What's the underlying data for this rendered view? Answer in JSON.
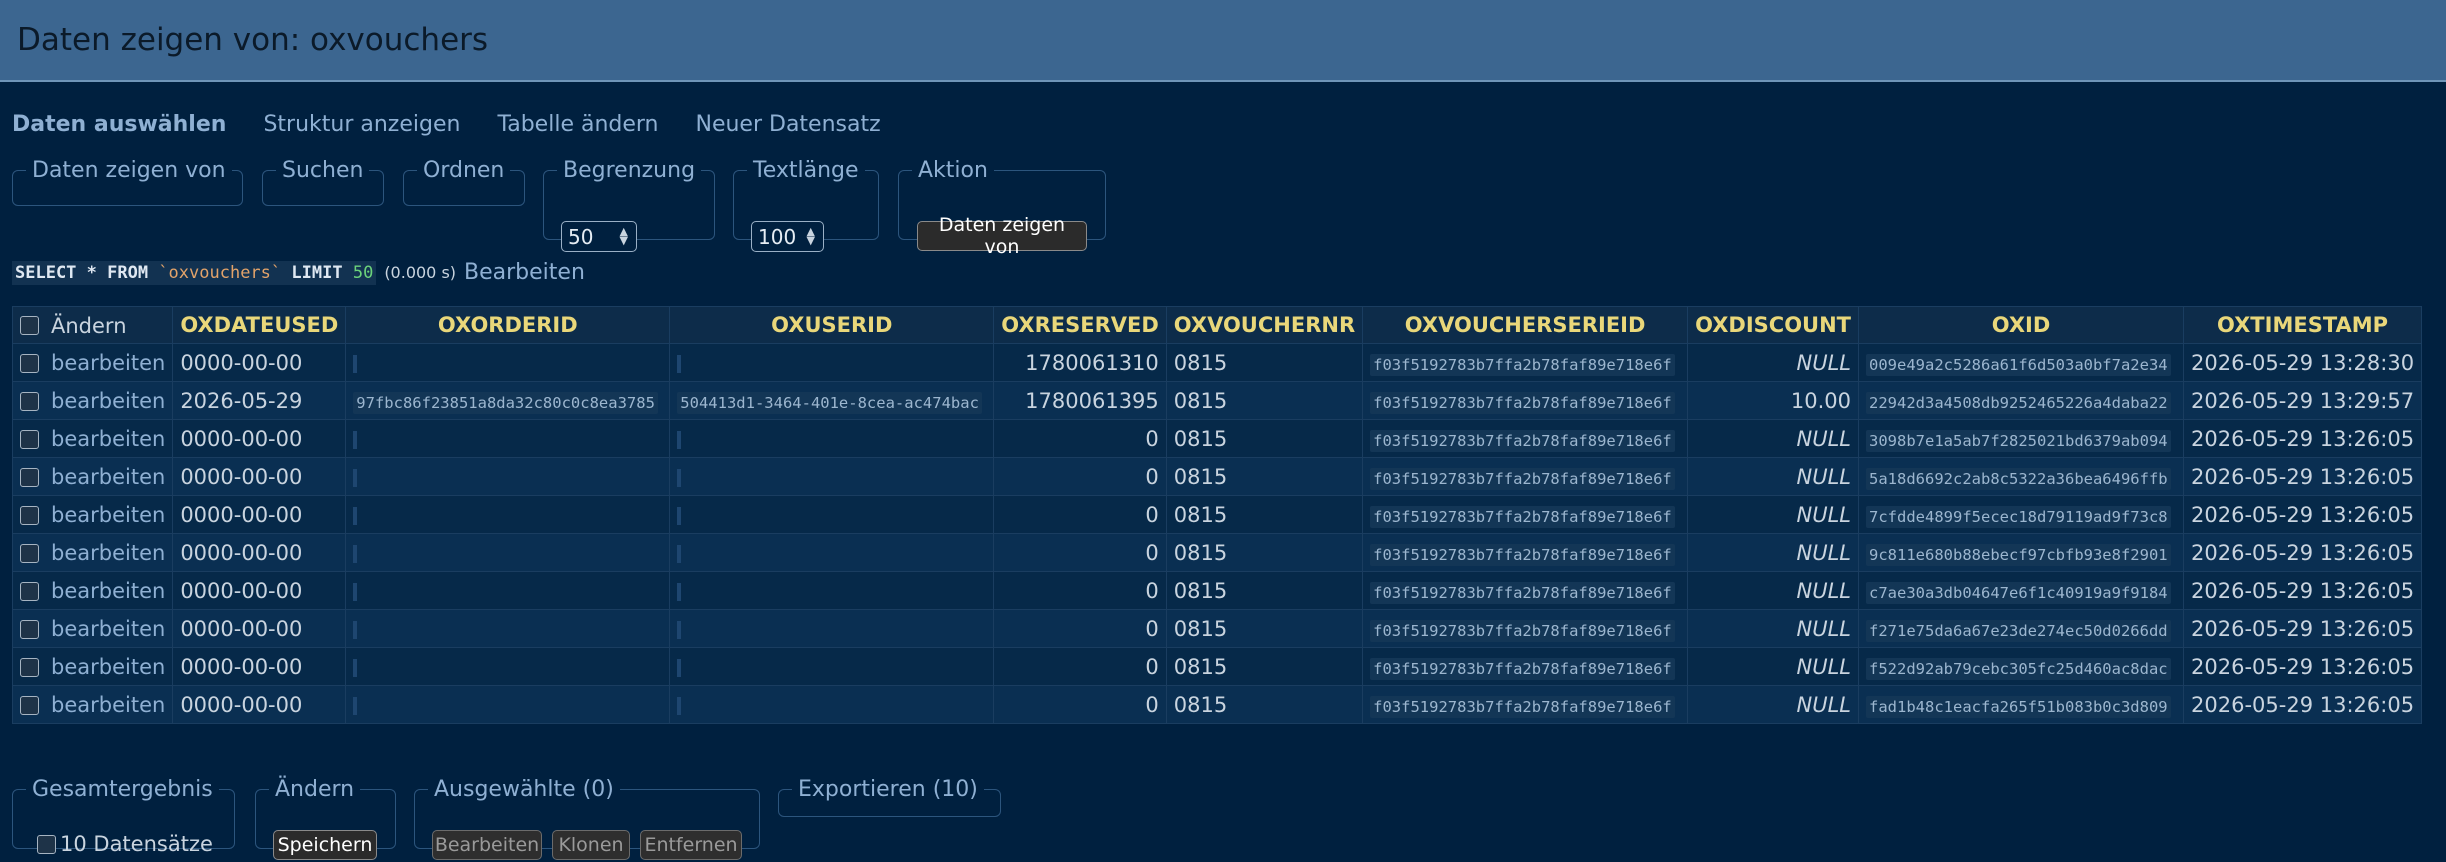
{
  "header": {
    "title": "Daten zeigen von: oxvouchers"
  },
  "tabs": [
    {
      "label": "Daten auswählen",
      "active": true
    },
    {
      "label": "Struktur anzeigen"
    },
    {
      "label": "Tabelle ändern"
    },
    {
      "label": "Neuer Datensatz"
    }
  ],
  "filters": {
    "select_legend": "Daten zeigen von",
    "search_legend": "Suchen",
    "order_legend": "Ordnen",
    "limit_legend": "Begrenzung",
    "limit_value": "50",
    "textlength_legend": "Textlänge",
    "textlength_value": "100",
    "action_legend": "Aktion",
    "action_button": "Daten zeigen von"
  },
  "query": {
    "keyword_select": "SELECT * FROM",
    "table": "`oxvouchers`",
    "keyword_limit": "LIMIT",
    "limit": "50",
    "time": "(0.000 s)",
    "edit_link": "Bearbeiten"
  },
  "table": {
    "edit_header": "Ändern",
    "columns": [
      "OXDATEUSED",
      "OXORDERID",
      "OXUSERID",
      "OXRESERVED",
      "OXVOUCHERNR",
      "OXVOUCHERSERIEID",
      "OXDISCOUNT",
      "OXID",
      "OXTIMESTAMP"
    ],
    "edit_label": "bearbeiten",
    "rows": [
      {
        "dateused": "0000-00-00",
        "orderid": "",
        "userid": "",
        "reserved": "1780061310",
        "vouchernr": "0815",
        "serieid": "f03f5192783b7ffa2b78faf89e718e6f",
        "discount": "NULL",
        "oxid": "009e49a2c5286a61f6d503a0bf7a2e34",
        "timestamp": "2026-05-29 13:28:30"
      },
      {
        "dateused": "2026-05-29",
        "orderid": "97fbc86f23851a8da32c80c0c8ea3785",
        "userid": "504413d1-3464-401e-8cea-ac474bac",
        "reserved": "1780061395",
        "vouchernr": "0815",
        "serieid": "f03f5192783b7ffa2b78faf89e718e6f",
        "discount": "10.00",
        "oxid": "22942d3a4508db9252465226a4daba22",
        "timestamp": "2026-05-29 13:29:57"
      },
      {
        "dateused": "0000-00-00",
        "orderid": "",
        "userid": "",
        "reserved": "0",
        "vouchernr": "0815",
        "serieid": "f03f5192783b7ffa2b78faf89e718e6f",
        "discount": "NULL",
        "oxid": "3098b7e1a5ab7f2825021bd6379ab094",
        "timestamp": "2026-05-29 13:26:05"
      },
      {
        "dateused": "0000-00-00",
        "orderid": "",
        "userid": "",
        "reserved": "0",
        "vouchernr": "0815",
        "serieid": "f03f5192783b7ffa2b78faf89e718e6f",
        "discount": "NULL",
        "oxid": "5a18d6692c2ab8c5322a36bea6496ffb",
        "timestamp": "2026-05-29 13:26:05"
      },
      {
        "dateused": "0000-00-00",
        "orderid": "",
        "userid": "",
        "reserved": "0",
        "vouchernr": "0815",
        "serieid": "f03f5192783b7ffa2b78faf89e718e6f",
        "discount": "NULL",
        "oxid": "7cfdde4899f5ecec18d79119ad9f73c8",
        "timestamp": "2026-05-29 13:26:05"
      },
      {
        "dateused": "0000-00-00",
        "orderid": "",
        "userid": "",
        "reserved": "0",
        "vouchernr": "0815",
        "serieid": "f03f5192783b7ffa2b78faf89e718e6f",
        "discount": "NULL",
        "oxid": "9c811e680b88ebecf97cbfb93e8f2901",
        "timestamp": "2026-05-29 13:26:05"
      },
      {
        "dateused": "0000-00-00",
        "orderid": "",
        "userid": "",
        "reserved": "0",
        "vouchernr": "0815",
        "serieid": "f03f5192783b7ffa2b78faf89e718e6f",
        "discount": "NULL",
        "oxid": "c7ae30a3db04647e6f1c40919a9f9184",
        "timestamp": "2026-05-29 13:26:05"
      },
      {
        "dateused": "0000-00-00",
        "orderid": "",
        "userid": "",
        "reserved": "0",
        "vouchernr": "0815",
        "serieid": "f03f5192783b7ffa2b78faf89e718e6f",
        "discount": "NULL",
        "oxid": "f271e75da6a67e23de274ec50d0266dd",
        "timestamp": "2026-05-29 13:26:05"
      },
      {
        "dateused": "0000-00-00",
        "orderid": "",
        "userid": "",
        "reserved": "0",
        "vouchernr": "0815",
        "serieid": "f03f5192783b7ffa2b78faf89e718e6f",
        "discount": "NULL",
        "oxid": "f522d92ab79cebc305fc25d460ac8dac",
        "timestamp": "2026-05-29 13:26:05"
      },
      {
        "dateused": "0000-00-00",
        "orderid": "",
        "userid": "",
        "reserved": "0",
        "vouchernr": "0815",
        "serieid": "f03f5192783b7ffa2b78faf89e718e6f",
        "discount": "NULL",
        "oxid": "fad1b48c1eacfa265f51b083b0c3d809",
        "timestamp": "2026-05-29 13:26:05"
      }
    ]
  },
  "footer": {
    "total_legend": "Gesamtergebnis",
    "total_label": "10 Datensätze",
    "modify_legend": "Ändern",
    "save_button": "Speichern",
    "selected_legend": "Ausgewählte (0)",
    "edit_button": "Bearbeiten",
    "clone_button": "Klonen",
    "delete_button": "Entfernen",
    "export_legend": "Exportieren (10)"
  }
}
